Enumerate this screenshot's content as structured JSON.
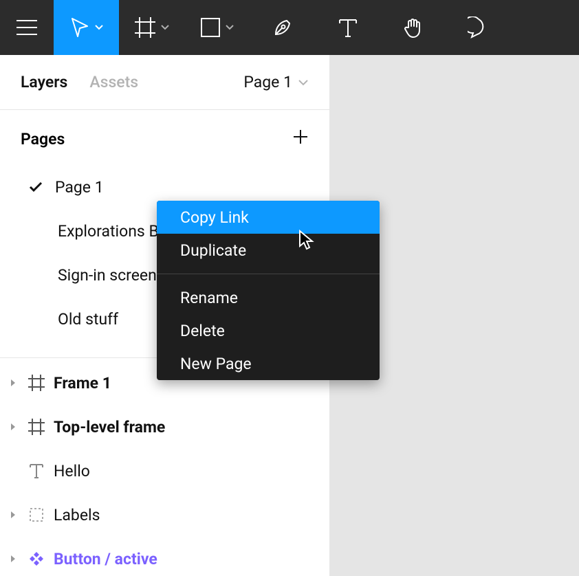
{
  "toolbar": {
    "tools": [
      "menu",
      "move",
      "frame",
      "shape",
      "pen",
      "text",
      "hand",
      "comment"
    ]
  },
  "sidebar": {
    "tabs": {
      "layers": "Layers",
      "assets": "Assets"
    },
    "pageDropdown": "Page 1",
    "pagesHeader": "Pages",
    "pages": [
      {
        "label": "Page 1",
        "selected": true
      },
      {
        "label": "Explorations B",
        "selected": false
      },
      {
        "label": "Sign-in screen",
        "selected": false
      },
      {
        "label": "Old stuff",
        "selected": false
      }
    ],
    "layers": [
      {
        "kind": "frame",
        "label": "Frame 1",
        "bold": true,
        "expandable": true
      },
      {
        "kind": "frame",
        "label": "Top-level frame",
        "bold": true,
        "expandable": true
      },
      {
        "kind": "text",
        "label": "Hello",
        "bold": false,
        "expandable": false
      },
      {
        "kind": "group",
        "label": "Labels",
        "bold": false,
        "expandable": true
      },
      {
        "kind": "component",
        "label": "Button / active",
        "bold": true,
        "expandable": true
      }
    ]
  },
  "contextMenu": {
    "items": [
      {
        "label": "Copy Link",
        "hover": true
      },
      {
        "label": "Duplicate",
        "hover": false
      }
    ],
    "items2": [
      {
        "label": "Rename"
      },
      {
        "label": "Delete"
      },
      {
        "label": "New Page"
      }
    ]
  }
}
